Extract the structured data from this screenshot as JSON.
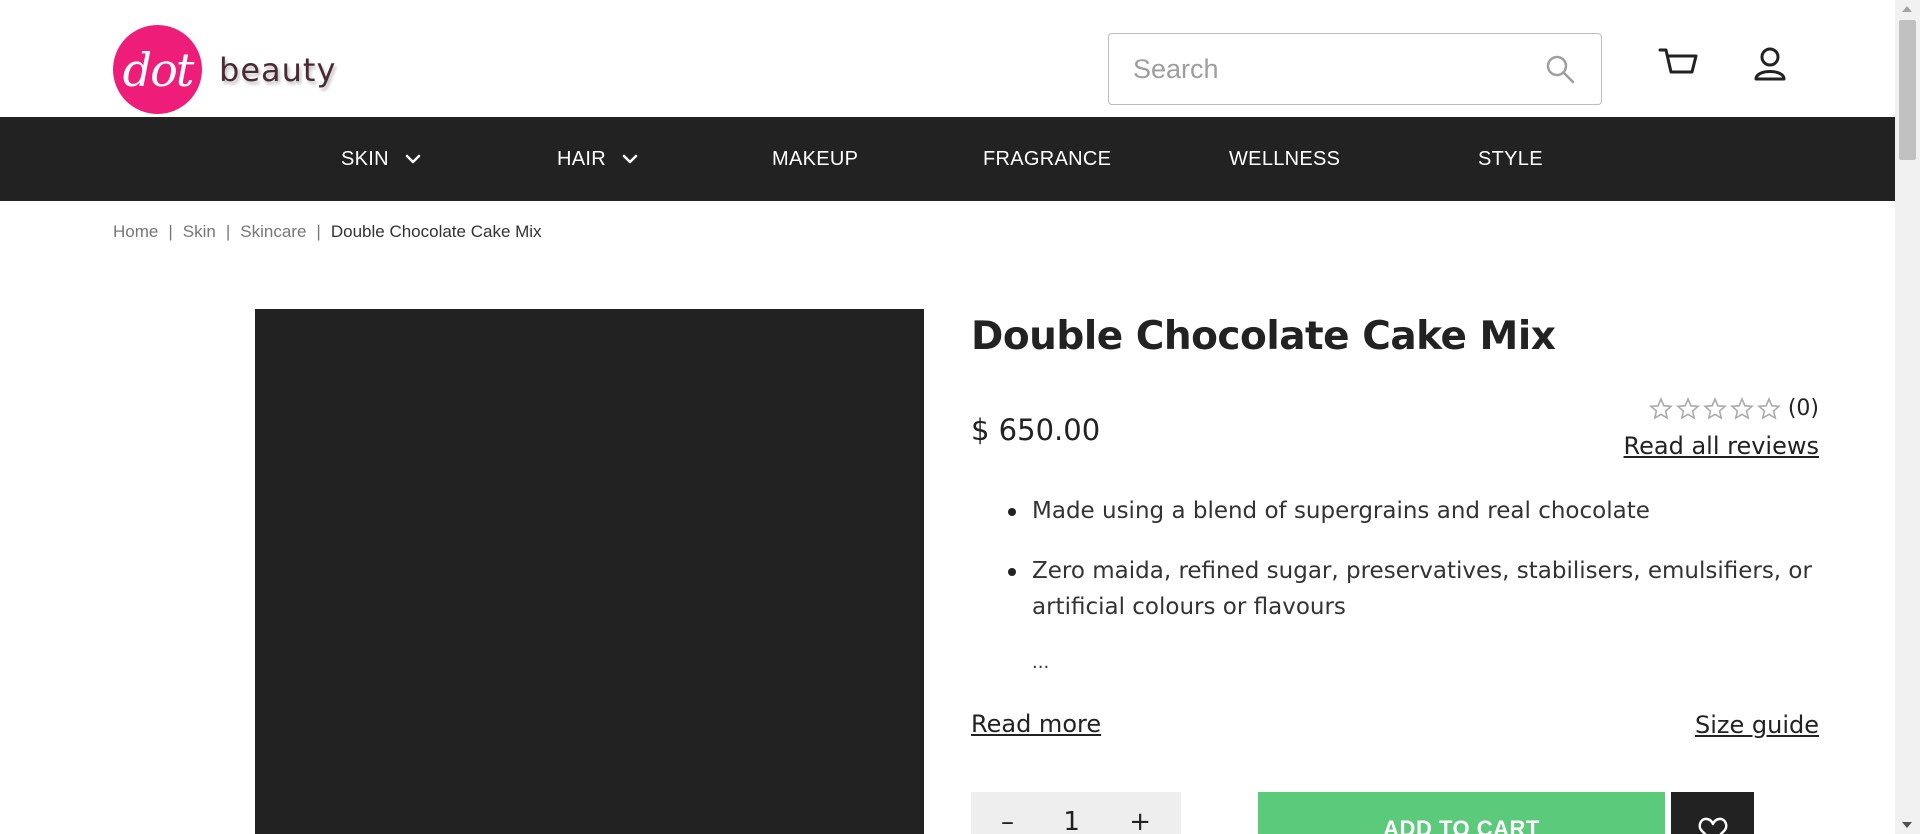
{
  "brand": {
    "logo_text": "dot",
    "name": "beauty",
    "logo_color": "#ee1d7a"
  },
  "search": {
    "placeholder": "Search",
    "value": ""
  },
  "header": {
    "cart_icon": "cart-icon",
    "account_icon": "user-icon"
  },
  "nav": {
    "items": [
      {
        "label": "SKIN",
        "has_dropdown": true
      },
      {
        "label": "HAIR",
        "has_dropdown": true
      },
      {
        "label": "MAKEUP",
        "has_dropdown": false
      },
      {
        "label": "FRAGRANCE",
        "has_dropdown": false
      },
      {
        "label": "WELLNESS",
        "has_dropdown": false
      },
      {
        "label": "STYLE",
        "has_dropdown": false
      }
    ]
  },
  "breadcrumb": {
    "items": [
      "Home",
      "Skin",
      "Skincare"
    ],
    "current": "Double Chocolate Cake Mix",
    "separator": "|"
  },
  "product": {
    "title": "Double Chocolate Cake Mix",
    "price": "$ 650.00",
    "rating_stars": 0,
    "rating_max": 5,
    "review_count": "(0)",
    "read_reviews": "Read all reviews",
    "bullets": [
      "Made using a blend of supergrains and real chocolate",
      "Zero maida, refined sugar, preservatives, stabilisers, emulsifiers, or artificial colours or flavours"
    ],
    "ellipsis": "...",
    "read_more": "Read more",
    "size_guide": "Size guide",
    "quantity": "1",
    "qty_minus": "–",
    "qty_plus": "+",
    "add_to_cart": "ADD TO CART",
    "add_to_cart_color": "#5cca7b"
  },
  "colors": {
    "nav_bg": "#222222",
    "image_bg": "#222222"
  }
}
